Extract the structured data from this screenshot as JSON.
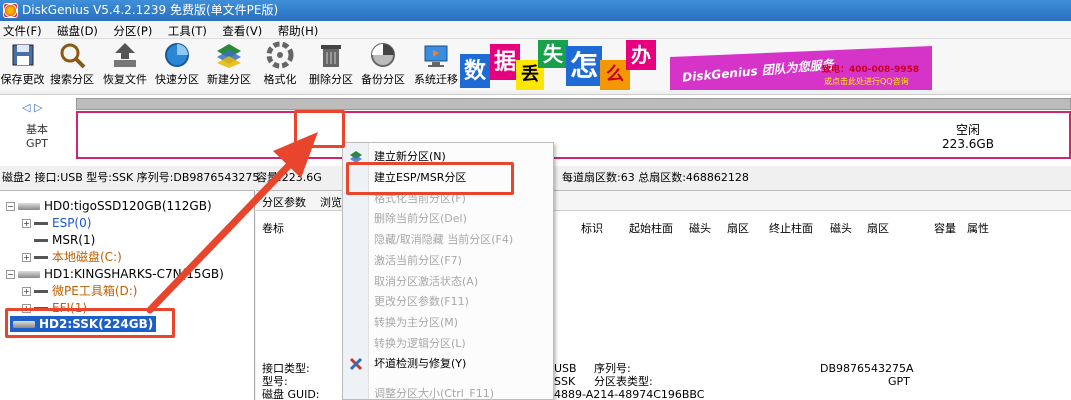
{
  "window": {
    "title": "DiskGenius V5.4.2.1239 免费版(单文件PE版)"
  },
  "menu": [
    "文件(F)",
    "磁盘(D)",
    "分区(P)",
    "工具(T)",
    "查看(V)",
    "帮助(H)"
  ],
  "toolbar": [
    {
      "label": "保存更改",
      "icon": "save-icon"
    },
    {
      "label": "搜索分区",
      "icon": "magnifier-icon"
    },
    {
      "label": "恢复文件",
      "icon": "restore-file-icon"
    },
    {
      "label": "快速分区",
      "icon": "quick-partition-icon"
    },
    {
      "label": "新建分区",
      "icon": "new-partition-icon"
    },
    {
      "label": "格式化",
      "icon": "format-icon"
    },
    {
      "label": "删除分区",
      "icon": "trash-icon"
    },
    {
      "label": "备份分区",
      "icon": "backup-icon"
    },
    {
      "label": "系统迁移",
      "icon": "migrate-icon"
    }
  ],
  "banner": {
    "tiles": [
      "数",
      "据",
      "丢",
      "失",
      "怎",
      "么",
      "办"
    ],
    "slogan": "DiskGenius 团队为您服务",
    "phone": "致电：400-008-9958",
    "link": "或点击此处进行QQ咨询",
    "colors": [
      "#1e6bd6",
      "#e6007e",
      "#ffe600",
      "#19a04a",
      "#1e6bd6",
      "#f39800",
      "#e6007e"
    ]
  },
  "diskmap": {
    "nav": "◁ ▷",
    "type_line1": "基本",
    "type_line2": "GPT",
    "free_label": "空闲",
    "free_size": "223.6GB"
  },
  "infobar": {
    "left": "磁盘2 接口:USB  型号:SSK  序列号:DB9876543275",
    "mid": "容量:223.6G",
    "right": "每道扇区数:63  总扇区数:468862128"
  },
  "tree": [
    {
      "label": "HD0:tigoSSD120GB(112GB)",
      "kind": "disk"
    },
    {
      "label": "ESP(0)",
      "kind": "part",
      "color": "#1a55d6"
    },
    {
      "label": "MSR(1)",
      "kind": "part",
      "color": "#000000"
    },
    {
      "label": "本地磁盘(C:)",
      "kind": "part",
      "color": "#c06000"
    },
    {
      "label": "HD1:KINGSHARKS-C7N(15GB)",
      "kind": "disk"
    },
    {
      "label": "微PE工具箱(D:)",
      "kind": "part",
      "color": "#c06000"
    },
    {
      "label": "EFI(1)",
      "kind": "part",
      "color": "#c06000"
    },
    {
      "label": "HD2:SSK(224GB)",
      "kind": "disk",
      "selected": true
    }
  ],
  "tabs": [
    "分区参数",
    "浏览"
  ],
  "columns": {
    "volume": "卷标",
    "headers": [
      "标识",
      "起始柱面",
      "磁头",
      "扇区",
      "终止柱面",
      "磁头",
      "扇区",
      "容量",
      "属性"
    ]
  },
  "details": {
    "labels": [
      "接口类型:",
      "型号:",
      "磁盘 GUID:"
    ],
    "values_mid": [
      "USB",
      "SSK",
      "4889-A214-48974C196BBC"
    ],
    "labels2": [
      "序列号:",
      "分区表类型:"
    ],
    "values_right": [
      "DB9876543275A",
      "GPT"
    ]
  },
  "context_menu": [
    {
      "label": "建立新分区(N)",
      "disabled": false
    },
    {
      "label": "建立ESP/MSR分区",
      "disabled": false
    },
    {
      "label": "格式化当前分区(F)",
      "disabled": true
    },
    {
      "label": "删除当前分区(Del)",
      "disabled": true
    },
    {
      "label": "隐藏/取消隐藏 当前分区(F4)",
      "disabled": true
    },
    {
      "label": "激活当前分区(F7)",
      "disabled": true
    },
    {
      "label": "取消分区激活状态(A)",
      "disabled": true
    },
    {
      "label": "更改分区参数(F11)",
      "disabled": true
    },
    {
      "label": "转换为主分区(M)",
      "disabled": true
    },
    {
      "label": "转换为逻辑分区(L)",
      "disabled": true
    },
    {
      "label": "坏道检测与修复(Y)",
      "disabled": false
    },
    {
      "label": "调整分区大小(Ctrl_F11)",
      "disabled": true
    }
  ],
  "accent": "#e8452c"
}
